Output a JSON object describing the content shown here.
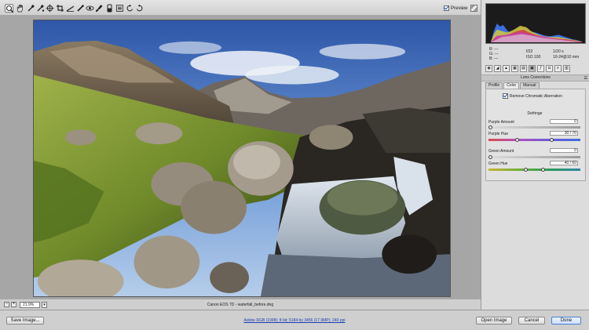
{
  "toolbar": {
    "preview_label": "Preview",
    "preview_checked": true,
    "tools": [
      "zoom-icon",
      "hand-icon",
      "white-balance-icon",
      "color-sampler-icon",
      "targeted-adjustment-icon",
      "crop-icon",
      "straighten-icon",
      "spot-removal-icon",
      "red-eye-icon",
      "adjustment-brush-icon",
      "graduated-filter-icon",
      "preferences-icon",
      "rotate-left-icon",
      "rotate-right-icon"
    ]
  },
  "status": {
    "zoom": "21.9%",
    "filename": "Canon EOS 7D  -  waterfall_before.dng"
  },
  "info": {
    "r_label": "R:",
    "g_label": "G:",
    "b_label": "B:",
    "r_value": "---",
    "g_value": "---",
    "b_value": "---",
    "aperture": "f/22",
    "shutter": "1/20 s",
    "iso": "ISO 100",
    "lens": "10-24@10 mm"
  },
  "panel": {
    "section_title": "Lens Corrections",
    "tabs": [
      "Profile",
      "Color",
      "Manual"
    ],
    "selected_tab": "Color",
    "remove_ca_label": "Remove Chromatic Aberration",
    "remove_ca_checked": true,
    "defringe_title": "Defringe",
    "sliders": {
      "purple_amount": {
        "label": "Purple Amount",
        "value": "0",
        "level": 0
      },
      "purple_hue": {
        "label": "Purple Hue",
        "value": "30 / 70",
        "low": 30,
        "high": 70
      },
      "green_amount": {
        "label": "Green Amount",
        "value": "0",
        "level": 0
      },
      "green_hue": {
        "label": "Green Hue",
        "value": "40 / 60",
        "low": 40,
        "high": 60
      }
    }
  },
  "bottom": {
    "save_label": "Save Image...",
    "workflow_link": "Adobe RGB (1998); 8 bit; 5184 by 3456 (17.9MP); 240 ppi",
    "open_label": "Open Image",
    "cancel_label": "Cancel",
    "done_label": "Done"
  },
  "colors": {
    "accent": "#4a7fd2",
    "link": "#1a3fb0"
  }
}
